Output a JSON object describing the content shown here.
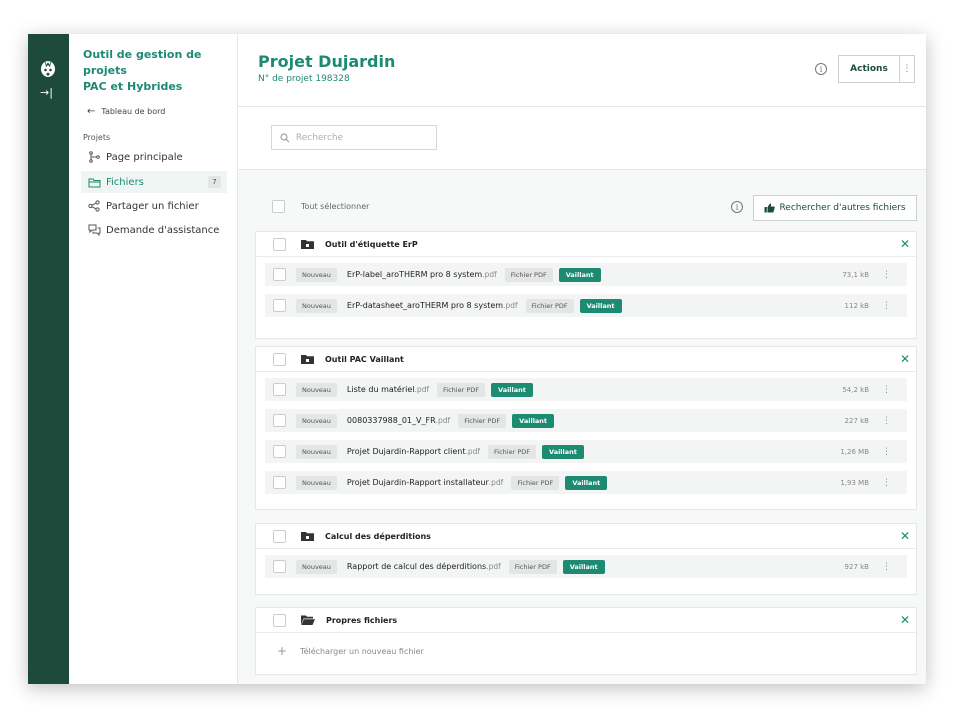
{
  "app": {
    "title_line1": "Outil de gestion de projets",
    "title_line2": "PAC et Hybrides"
  },
  "sidebar": {
    "back_label": "Tableau de bord",
    "section_label": "Projets",
    "items": [
      {
        "label": "Page principale",
        "icon": "branch-icon"
      },
      {
        "label": "Fichiers",
        "icon": "folder-icon",
        "count": "7",
        "active": true
      },
      {
        "label": "Partager un fichier",
        "icon": "share-icon"
      },
      {
        "label": "Demande d'assistance",
        "icon": "chat-icon"
      }
    ]
  },
  "header": {
    "title": "Projet Dujardin",
    "subtitle": "N° de projet 198328",
    "actions_label": "Actions"
  },
  "search": {
    "placeholder": "Recherche"
  },
  "toolbar": {
    "select_all_label": "Tout sélectionner",
    "search_more_label": "Rechercher d'autres fichiers"
  },
  "groups": [
    {
      "name": "Outil d'étiquette ErP",
      "files": [
        {
          "badge": "Nouveau",
          "name": "ErP-label_aroTHERM pro 8 system",
          "ext": ".pdf",
          "type": "Fichier PDF",
          "brand": "Vaillant",
          "size": "73,1 kB"
        },
        {
          "badge": "Nouveau",
          "name": "ErP-datasheet_aroTHERM pro 8 system",
          "ext": ".pdf",
          "type": "Fichier PDF",
          "brand": "Vaillant",
          "size": "112 kB"
        }
      ]
    },
    {
      "name": "Outil PAC Vaillant",
      "files": [
        {
          "badge": "Nouveau",
          "name": "Liste du matériel",
          "ext": ".pdf",
          "type": "Fichier PDF",
          "brand": "Vaillant",
          "size": "54,2 kB"
        },
        {
          "badge": "Nouveau",
          "name": "0080337988_01_V_FR",
          "ext": ".pdf",
          "type": "Fichier PDF",
          "brand": "Vaillant",
          "size": "227 kB"
        },
        {
          "badge": "Nouveau",
          "name": "Projet Dujardin-Rapport client",
          "ext": ".pdf",
          "type": "Fichier PDF",
          "brand": "Vaillant",
          "size": "1,26 MB"
        },
        {
          "badge": "Nouveau",
          "name": "Projet Dujardin-Rapport installateur",
          "ext": ".pdf",
          "type": "Fichier PDF",
          "brand": "Vaillant",
          "size": "1,93 MB"
        }
      ]
    },
    {
      "name": "Calcul des déperditions",
      "files": [
        {
          "badge": "Nouveau",
          "name": "Rapport de calcul des déperditions",
          "ext": ".pdf",
          "type": "Fichier PDF",
          "brand": "Vaillant",
          "size": "927 kB"
        }
      ]
    },
    {
      "name": "Propres fichiers",
      "files": [],
      "upload_label": "Télécharger un nouveau fichier"
    }
  ],
  "colors": {
    "brand": "#1d8a72",
    "rail": "#1e4a3c"
  }
}
